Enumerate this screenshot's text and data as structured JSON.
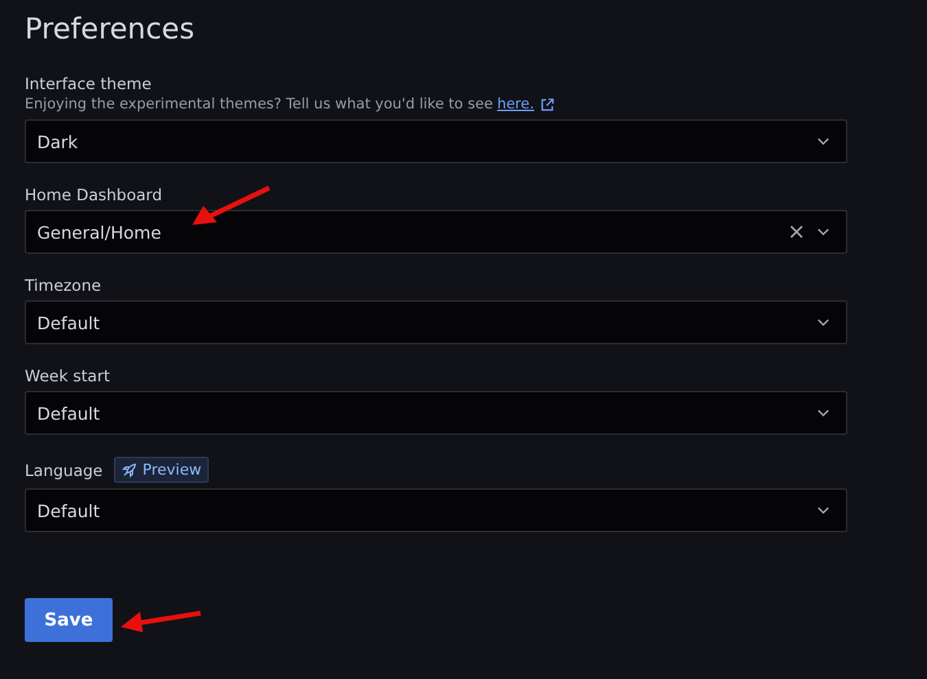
{
  "title": "Preferences",
  "fields": [
    {
      "label": "Interface theme",
      "description": "Enjoying the experimental themes? Tell us what you'd like to see ",
      "link": "here.",
      "value": "Dark",
      "clearable": false,
      "arrow": false
    },
    {
      "label": "Home Dashboard",
      "value": "General/Home",
      "clearable": true,
      "arrow": true
    },
    {
      "label": "Timezone",
      "value": "Default",
      "clearable": false,
      "arrow": false
    },
    {
      "label": "Week start",
      "value": "Default",
      "clearable": false,
      "arrow": false
    },
    {
      "label": "Language",
      "badge": "Preview",
      "value": "Default",
      "clearable": false,
      "arrow": false
    }
  ],
  "save_button": {
    "label": "Save",
    "arrow": true
  }
}
